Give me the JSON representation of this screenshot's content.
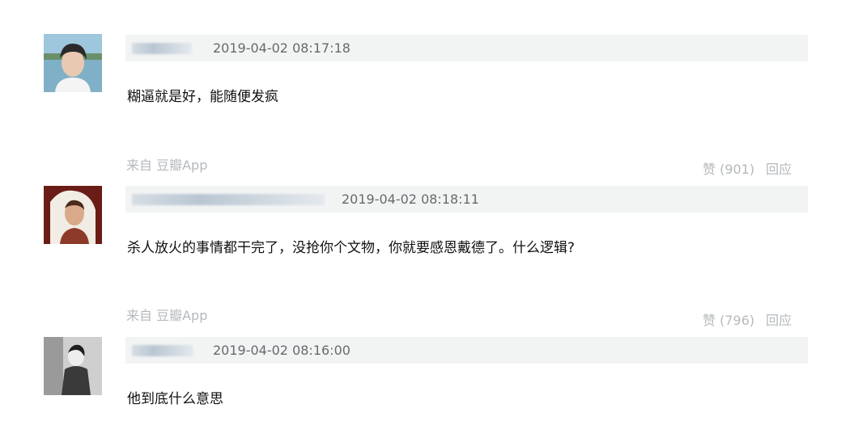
{
  "comments": [
    {
      "time": "2019-04-02 08:17:18",
      "text": "糊逼就是好，能随便发疯",
      "source": "来自 豆瓣App",
      "like_label": "赞 (901)",
      "reply_label": "回应"
    },
    {
      "time": "2019-04-02 08:18:11",
      "text": "杀人放火的事情都干完了，没抢你个文物，你就要感恩戴德了。什么逻辑?",
      "source": "来自 豆瓣App",
      "like_label": "赞 (796)",
      "reply_label": "回应"
    },
    {
      "time": "2019-04-02 08:16:00",
      "text": "他到底什么意思"
    }
  ],
  "colors": {
    "meta_bar": "#f2f4f4",
    "muted_text": "#b5b9bc",
    "timestamp": "#666a6d"
  }
}
